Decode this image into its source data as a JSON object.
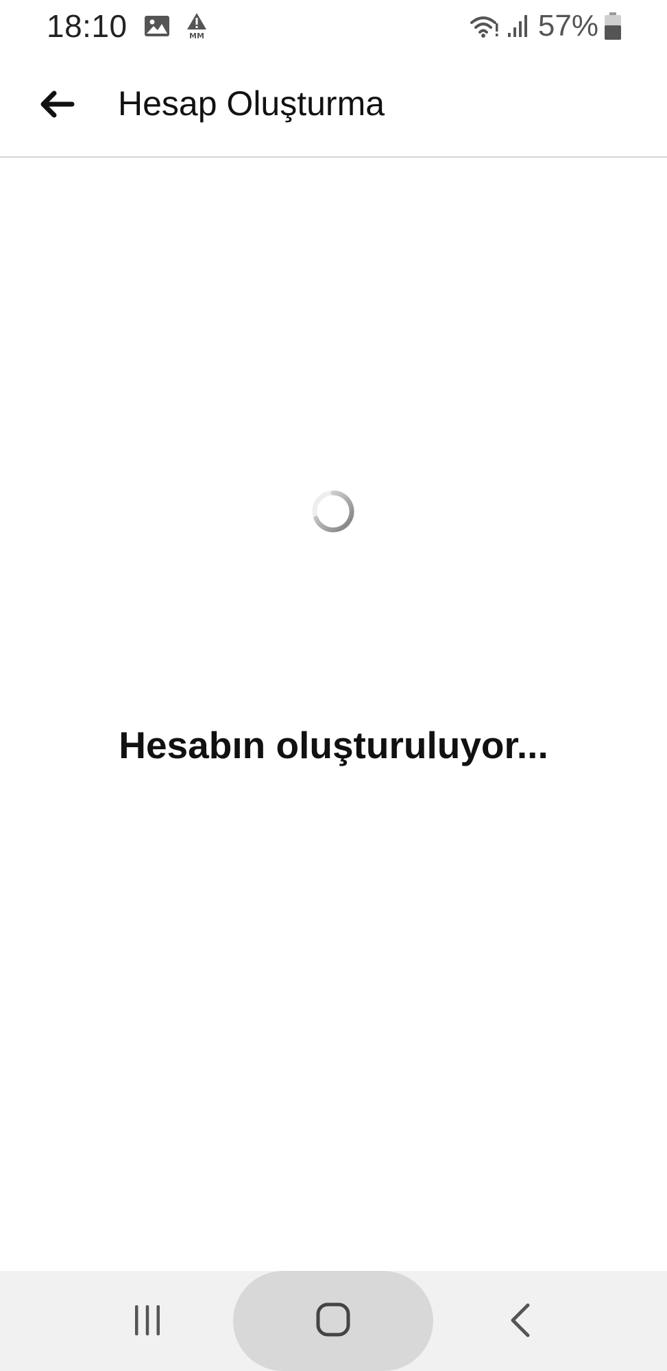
{
  "status_bar": {
    "time": "18:10",
    "battery_percent_text": "57%",
    "battery_level": 0.57,
    "icons": [
      "gallery-icon",
      "alert-icon",
      "wifi-icon",
      "signal-icon",
      "battery-icon"
    ]
  },
  "app_bar": {
    "back_icon": "arrow-left-icon",
    "title": "Hesap Oluşturma"
  },
  "main": {
    "spinner_icon": "loading-spinner-icon",
    "loading_text": "Hesabın oluşturuluyor..."
  },
  "nav_bar": {
    "recents_icon": "recents-icon",
    "home_icon": "home-icon",
    "back_icon": "chevron-left-icon"
  },
  "colors": {
    "background": "#ffffff",
    "text": "#111111",
    "status_icons": "#555555",
    "divider": "#d4d4d4",
    "nav_bar_bg": "#f1f1f1",
    "home_pill": "#d8d8d8",
    "spinner": "#888888"
  }
}
